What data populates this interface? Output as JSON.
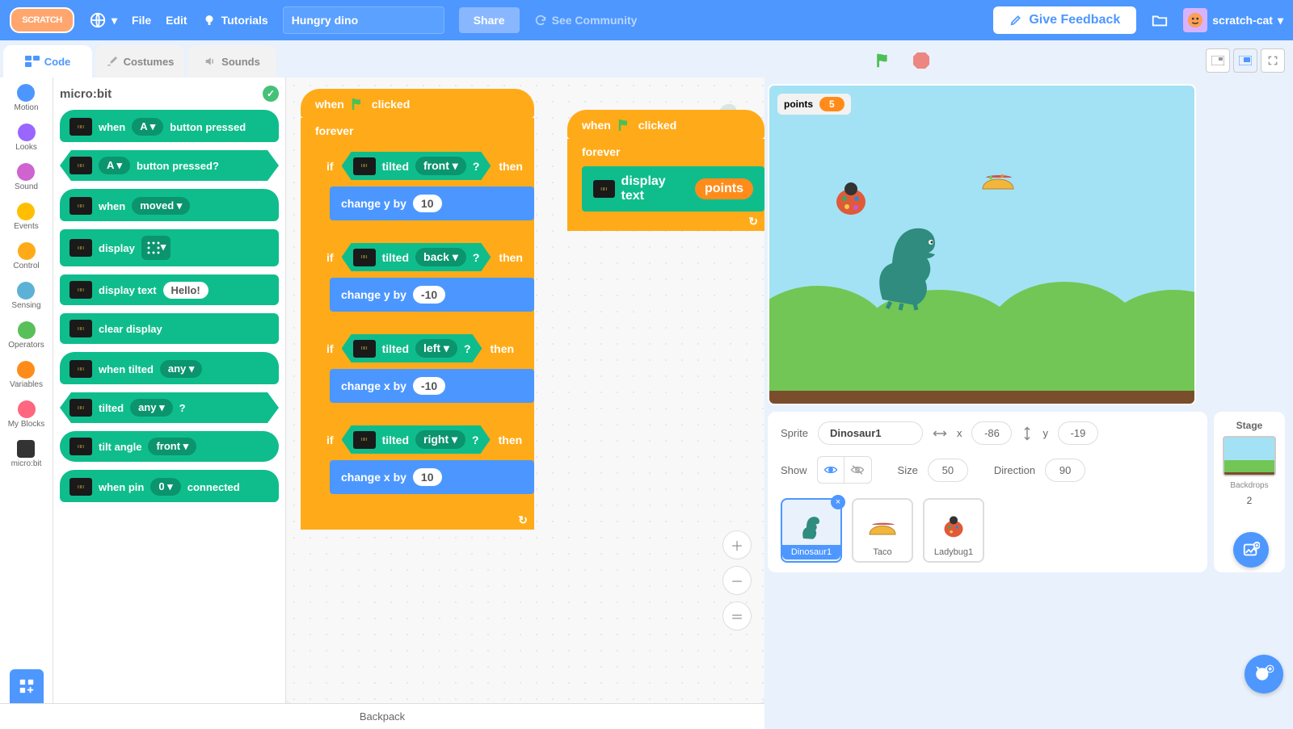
{
  "menu": {
    "file": "File",
    "edit": "Edit",
    "tutorials": "Tutorials",
    "project_title": "Hungry dino",
    "share": "Share",
    "see_community": "See Community",
    "feedback": "Give Feedback",
    "username": "scratch-cat"
  },
  "tabs": {
    "code": "Code",
    "costumes": "Costumes",
    "sounds": "Sounds"
  },
  "categories": [
    {
      "name": "Motion",
      "color": "#4c97ff"
    },
    {
      "name": "Looks",
      "color": "#9966ff"
    },
    {
      "name": "Sound",
      "color": "#cf63cf"
    },
    {
      "name": "Events",
      "color": "#ffbf00"
    },
    {
      "name": "Control",
      "color": "#ffab19"
    },
    {
      "name": "Sensing",
      "color": "#5cb1d6"
    },
    {
      "name": "Operators",
      "color": "#59c059"
    },
    {
      "name": "Variables",
      "color": "#ff8c1a"
    },
    {
      "name": "My Blocks",
      "color": "#ff6680"
    },
    {
      "name": "micro:bit",
      "color": "#333",
      "selected": true,
      "icon": true
    }
  ],
  "palette": {
    "header": "micro:bit",
    "blocks": {
      "when_button": {
        "pre": "when",
        "dd": "A ▾",
        "post": "button pressed"
      },
      "button_pressed": {
        "dd": "A ▾",
        "post": "button pressed?"
      },
      "when_moved": {
        "pre": "when",
        "dd": "moved ▾"
      },
      "display": {
        "pre": "display"
      },
      "display_text": {
        "pre": "display text",
        "pill": "Hello!"
      },
      "clear_display": {
        "pre": "clear display"
      },
      "when_tilted": {
        "pre": "when tilted",
        "dd": "any ▾"
      },
      "tilted": {
        "pre": "tilted",
        "dd": "any ▾",
        "post": "?"
      },
      "tilt_angle": {
        "pre": "tilt angle",
        "dd": "front ▾"
      },
      "when_pin": {
        "pre": "when pin",
        "dd": "0 ▾",
        "post": "connected"
      }
    }
  },
  "scripts": {
    "s1": {
      "hat": "when",
      "hat2": "clicked",
      "forever": "forever",
      "ifs": [
        {
          "if": "if",
          "tilted": "tilted",
          "dir": "front ▾",
          "q": "?",
          "then": "then",
          "action": "change y by",
          "val": "10"
        },
        {
          "if": "if",
          "tilted": "tilted",
          "dir": "back ▾",
          "q": "?",
          "then": "then",
          "action": "change y by",
          "val": "-10"
        },
        {
          "if": "if",
          "tilted": "tilted",
          "dir": "left ▾",
          "q": "?",
          "then": "then",
          "action": "change x by",
          "val": "-10"
        },
        {
          "if": "if",
          "tilted": "tilted",
          "dir": "right ▾",
          "q": "?",
          "then": "then",
          "action": "change x by",
          "val": "10"
        }
      ]
    },
    "s2": {
      "hat": "when",
      "hat2": "clicked",
      "forever": "forever",
      "display": "display text",
      "var": "points"
    }
  },
  "stage_monitor": {
    "label": "points",
    "value": "5"
  },
  "sprite_info": {
    "label_sprite": "Sprite",
    "name": "Dinosaur1",
    "x_label": "x",
    "x": "-86",
    "y_label": "y",
    "y": "-19",
    "show_label": "Show",
    "size_label": "Size",
    "size": "50",
    "dir_label": "Direction",
    "dir": "90"
  },
  "stage_panel": {
    "title": "Stage",
    "backdrops_label": "Backdrops",
    "backdrops": "2"
  },
  "sprites": [
    {
      "name": "Dinosaur1",
      "sel": true
    },
    {
      "name": "Taco"
    },
    {
      "name": "Ladybug1"
    }
  ],
  "backpack": "Backpack"
}
